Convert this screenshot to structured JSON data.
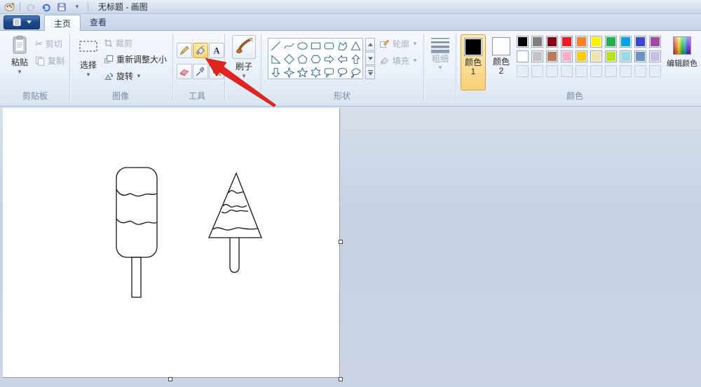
{
  "window": {
    "title": "无标题 - 画图"
  },
  "quick_access": {
    "icons": [
      "paint-logo",
      "redo",
      "undo",
      "save",
      "customize-dropdown"
    ]
  },
  "tabs": [
    {
      "label": "主页",
      "active": true
    },
    {
      "label": "查看",
      "active": false
    }
  ],
  "ribbon": {
    "clipboard": {
      "group_label": "剪贴板",
      "paste": "粘贴",
      "cut": "剪切",
      "copy": "复制"
    },
    "image": {
      "group_label": "图像",
      "select": "选择",
      "crop": "裁剪",
      "resize": "重新调整大小",
      "rotate": "旋转"
    },
    "tools": {
      "group_label": "工具",
      "items": [
        "pencil",
        "fill-bucket",
        "text",
        "eraser",
        "color-picker",
        "magnifier"
      ],
      "selected": "fill-bucket"
    },
    "brushes": {
      "label": "刷子"
    },
    "shapes": {
      "group_label": "形状",
      "outline": "轮廓",
      "fill": "填充",
      "items": [
        "line",
        "curve",
        "ellipse",
        "rectangle",
        "rounded-rectangle",
        "polygon",
        "triangle",
        "right-triangle",
        "diamond",
        "pentagon",
        "hexagon",
        "arrow-right",
        "arrow-left",
        "arrow-up",
        "arrow-down",
        "star-4",
        "star-5",
        "star-6",
        "callout-rounded",
        "callout-oval",
        "callout-cloud"
      ]
    },
    "size": {
      "label": "粗细"
    },
    "colors": {
      "group_label": "颜色",
      "color1_label": "颜色 1",
      "color2_label": "颜色 2",
      "color1_value": "#000000",
      "color2_value": "#FFFFFF",
      "edit_colors": "编辑颜色",
      "palette": [
        [
          "#000000",
          "#7F7F7F",
          "#880015",
          "#ED1C24",
          "#FF7F27",
          "#FFF200",
          "#22B14C",
          "#00A2E8",
          "#3F48CC",
          "#A349A4"
        ],
        [
          "#FFFFFF",
          "#C3C3C3",
          "#B97A57",
          "#FFAEC9",
          "#FFC90E",
          "#EFE4B0",
          "#B5E61D",
          "#99D9EA",
          "#7092BE",
          "#C8BFE7"
        ]
      ],
      "empty_slots": 10
    }
  },
  "canvas": {
    "drawings": [
      "popsicle-outline",
      "tree-popsicle-outline"
    ],
    "annotation": "red-arrow-pointing-to-fill-tool"
  }
}
